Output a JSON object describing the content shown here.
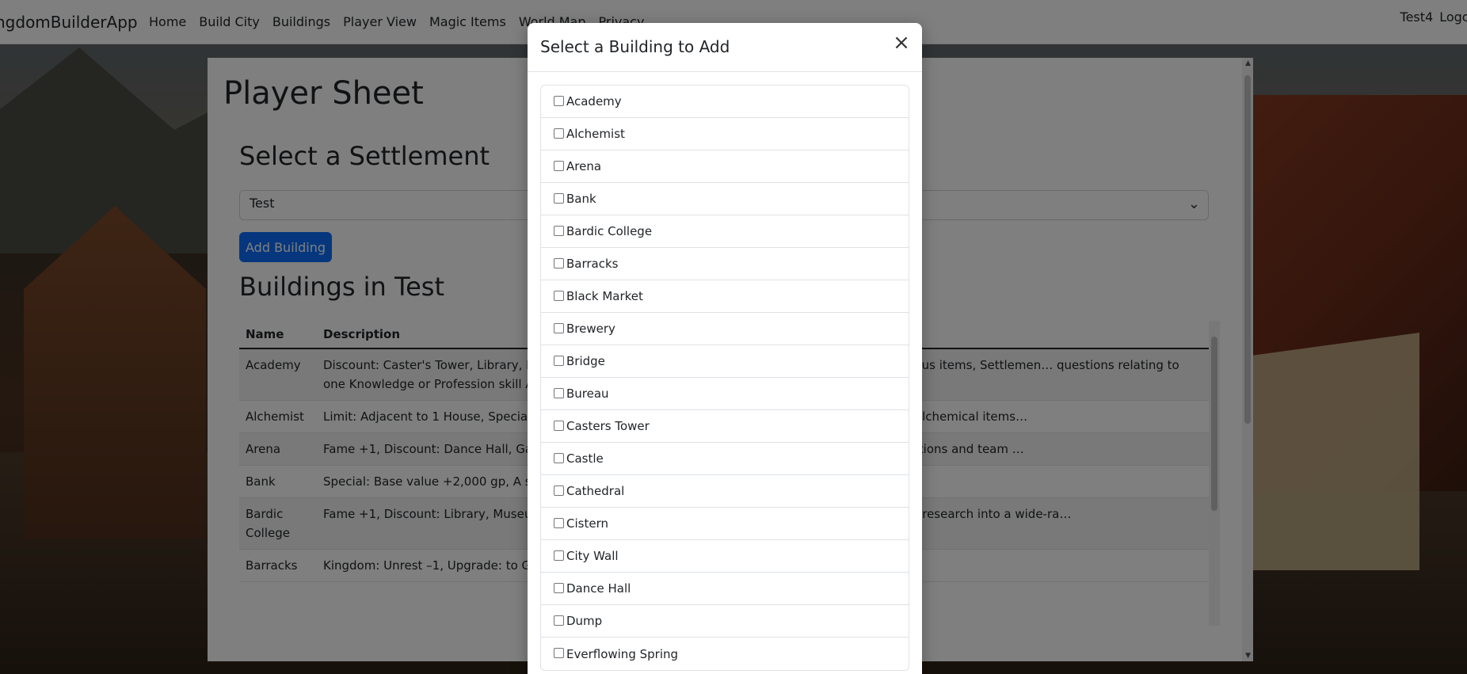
{
  "navbar": {
    "brand": "ngdomBuilderApp",
    "links": [
      "Home",
      "Build City",
      "Buildings",
      "Player View",
      "Magic Items",
      "World Map",
      "Privacy"
    ],
    "user": "Test4",
    "logout": "Logout"
  },
  "page": {
    "title": "Player Sheet",
    "select_heading": "Select a Settlement",
    "selected_settlement": "Test",
    "add_button": "Add Building",
    "buildings_heading": "Buildings in Test",
    "table": {
      "headers": [
        "Name",
        "Description"
      ],
      "rows": [
        {
          "name": "Academy",
          "description": "Discount: Caster's Tower, Library, Ma… minor scrolls or wondrous items, 2 medium scrolls or wondrous items, Settlemen… questions relating to one Knowledge or Profession skill An institution of high…"
        },
        {
          "name": "Alchemist",
          "description": "Limit: Adjacent to 1 House, Special: B… he laboratory and home of a crafter of poisons, potions, or alchemical items…"
        },
        {
          "name": "Arena",
          "description": "Fame +1, Discount: Dance Hall, Garri… r,Settlement: Crime +1, A large public structure for competitions and team …"
        },
        {
          "name": "Bank",
          "description": "Special: Base value +2,000 gp, A secu…"
        },
        {
          "name": "Bardic College",
          "description": "Fame +1, Discount: Library, Museum,… artistic learning. Education in a Bardic College also includes research into a wide-ra…"
        },
        {
          "name": "Barracks",
          "description": "Kingdom: Unrest –1, Upgrade: to Gar… nscripts, guards, militia, soldiers, or similar"
        }
      ]
    }
  },
  "modal": {
    "title": "Select a Building to Add",
    "close_icon": "close-icon",
    "items": [
      "Academy",
      "Alchemist",
      "Arena",
      "Bank",
      "Bardic College",
      "Barracks",
      "Black Market",
      "Brewery",
      "Bridge",
      "Bureau",
      "Casters Tower",
      "Castle",
      "Cathedral",
      "Cistern",
      "City Wall",
      "Dance Hall",
      "Dump",
      "Everflowing Spring"
    ]
  },
  "colors": {
    "primary": "#0d6efd",
    "overlay": "rgba(0,0,0,0.5)"
  }
}
